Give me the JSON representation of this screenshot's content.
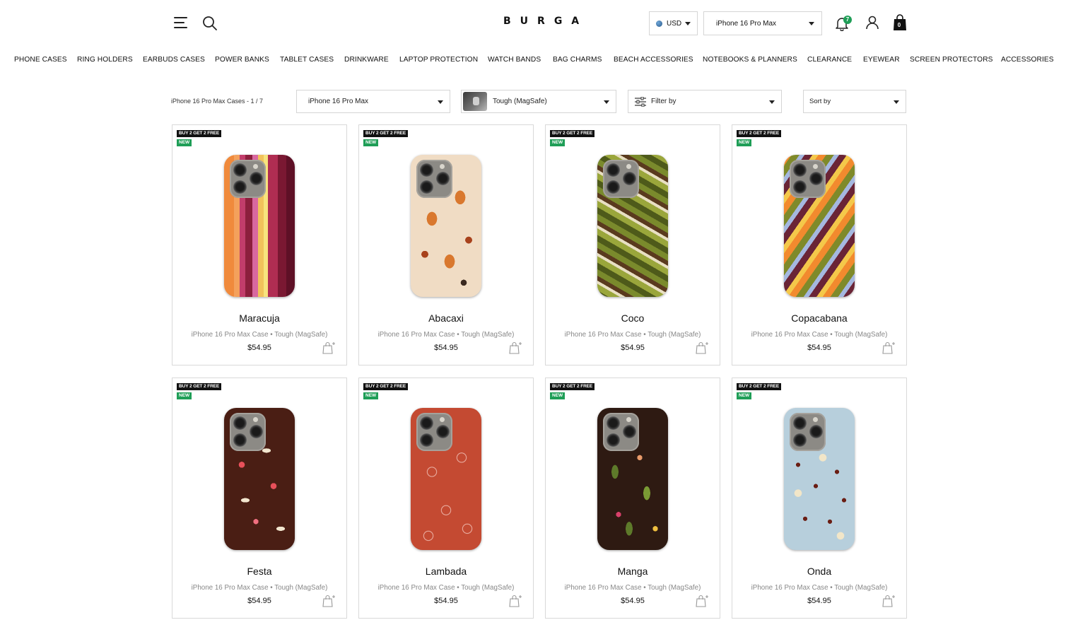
{
  "header": {
    "logo": "BURGA",
    "currency": "USD",
    "device": "iPhone 16 Pro Max",
    "notifications_count": "7",
    "cart_count": "0"
  },
  "nav": [
    "PHONE CASES",
    "RING HOLDERS",
    "EARBUDS CASES",
    "POWER BANKS",
    "TABLET CASES",
    "DRINKWARE",
    "LAPTOP PROTECTION",
    "WATCH BANDS",
    "BAG CHARMS",
    "BEACH ACCESSORIES",
    "NOTEBOOKS & PLANNERS",
    "CLEARANCE",
    "EYEWEAR",
    "SCREEN PROTECTORS",
    "ACCESSORIES"
  ],
  "filters": {
    "result_count": "iPhone 16 Pro Max Cases - 1 / 7",
    "device": "iPhone 16 Pro Max",
    "case_type": "Tough (MagSafe)",
    "filter_by": "Filter by",
    "sort_by": "Sort by"
  },
  "badges": {
    "promo": "BUY 2 GET 2 FREE",
    "new": "NEW"
  },
  "products": [
    {
      "name": "Maracuja",
      "subtitle": "iPhone 16 Pro Max Case •  Tough (MagSafe)",
      "price": "$54.95"
    },
    {
      "name": "Abacaxi",
      "subtitle": "iPhone 16 Pro Max Case •  Tough (MagSafe)",
      "price": "$54.95"
    },
    {
      "name": "Coco",
      "subtitle": "iPhone 16 Pro Max Case •  Tough (MagSafe)",
      "price": "$54.95"
    },
    {
      "name": "Copacabana",
      "subtitle": "iPhone 16 Pro Max Case •  Tough (MagSafe)",
      "price": "$54.95"
    },
    {
      "name": "Festa",
      "subtitle": "iPhone 16 Pro Max Case •  Tough (MagSafe)",
      "price": "$54.95"
    },
    {
      "name": "Lambada",
      "subtitle": "iPhone 16 Pro Max Case •  Tough (MagSafe)",
      "price": "$54.95"
    },
    {
      "name": "Manga",
      "subtitle": "iPhone 16 Pro Max Case •  Tough (MagSafe)",
      "price": "$54.95"
    },
    {
      "name": "Onda",
      "subtitle": "iPhone 16 Pro Max Case •  Tough (MagSafe)",
      "price": "$54.95"
    }
  ],
  "colors": {
    "new_badge": "#1f9e57",
    "promo_badge": "#111111",
    "border": "#d9d9d9"
  }
}
